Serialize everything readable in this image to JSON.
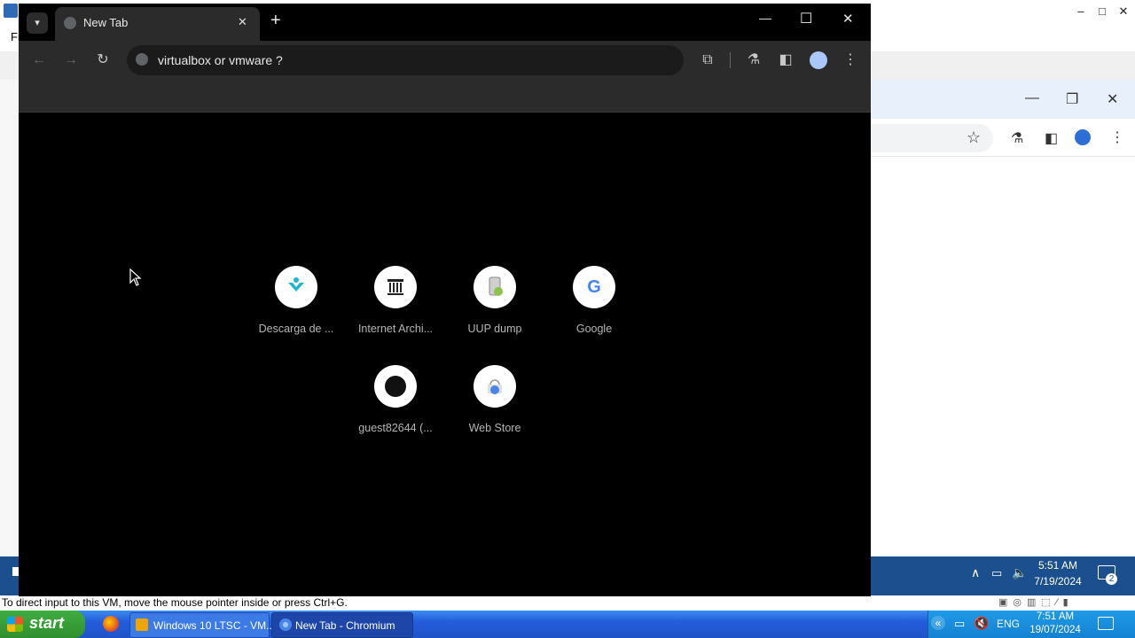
{
  "host": {
    "menu_first": "Fi",
    "minimize": "–",
    "maximize": "□",
    "close": "✕"
  },
  "chromium": {
    "tab_title": "New Tab",
    "tab_close": "✕",
    "new_tab": "+",
    "omnibox_text": "virtualbox or vmware ?",
    "win_min": "—",
    "win_max": "☐",
    "win_close": "✕",
    "shortcuts": [
      {
        "label": "Descarga de ...",
        "icon": "download-site-icon"
      },
      {
        "label": "Internet Archi...",
        "icon": "internet-archive-icon"
      },
      {
        "label": "UUP dump",
        "icon": "uup-dump-icon"
      },
      {
        "label": "Google",
        "icon": "google-icon"
      },
      {
        "label": "guest82644 (...",
        "icon": "github-icon"
      },
      {
        "label": "Web Store",
        "icon": "web-store-icon"
      }
    ]
  },
  "guest_taskbar": {
    "time": "5:51 AM",
    "date": "7/19/2024",
    "notifications": "2"
  },
  "vm_status": "To direct input to this VM, move the mouse pointer inside or press Ctrl+G.",
  "xp_taskbar": {
    "start": "start",
    "tasks": [
      "Windows 10 LTSC - VM...",
      "New Tab - Chromium"
    ],
    "lang": "ENG",
    "time": "7:51 AM",
    "date": "19/07/2024"
  },
  "colors": {
    "vm_taskbar": "#1c4f8d",
    "xp_taskbar": "#245ddb",
    "chrome_toolbar": "#2b2b2b"
  }
}
